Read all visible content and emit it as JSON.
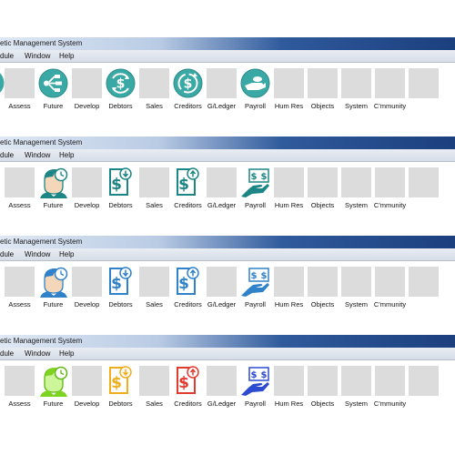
{
  "window": {
    "title": "etic Management System",
    "menu": [
      "dule",
      "Window",
      "Help"
    ]
  },
  "toolbar_labels": [
    "Assess",
    "Future",
    "Develop",
    "Debtors",
    "Sales",
    "Creditors",
    "G/Ledger",
    "Payroll",
    "Hum Res",
    "Objects",
    "System",
    "C'mmunity"
  ],
  "variants": [
    {
      "style": "round-teal",
      "icons": {
        "future": "network-branch-icon",
        "debtors": "dollar-circle-in-icon",
        "creditors": "dollar-circle-out-icon",
        "payroll": "hand-coin-icon"
      }
    },
    {
      "style": "flat-teal",
      "icons": {
        "future": "head-clock-icon",
        "debtors": "document-dollar-down-icon",
        "creditors": "document-dollar-up-icon",
        "payroll": "hand-banknote-icon"
      }
    },
    {
      "style": "flat-blue",
      "icons": {
        "future": "head-clock-icon",
        "debtors": "document-dollar-down-icon",
        "creditors": "document-dollar-up-icon",
        "payroll": "hand-banknote-icon"
      }
    },
    {
      "style": "multicolor",
      "icons": {
        "future": "head-clock-icon",
        "debtors": "document-dollar-down-icon",
        "creditors": "document-dollar-up-icon",
        "payroll": "hand-banknote-icon"
      }
    }
  ],
  "colors": {
    "round_teal": "#3aa8a4",
    "flat_teal": "#1c8585",
    "flat_blue": "#2f82c9",
    "future_green": "#7ed321",
    "debtors_yellow": "#f0ad1c",
    "creditors_red": "#e23a2f",
    "payroll_blue": "#2c4bd0",
    "tile_gray": "#dcdcdc",
    "titlebar_blue": "#1c3f7e"
  }
}
